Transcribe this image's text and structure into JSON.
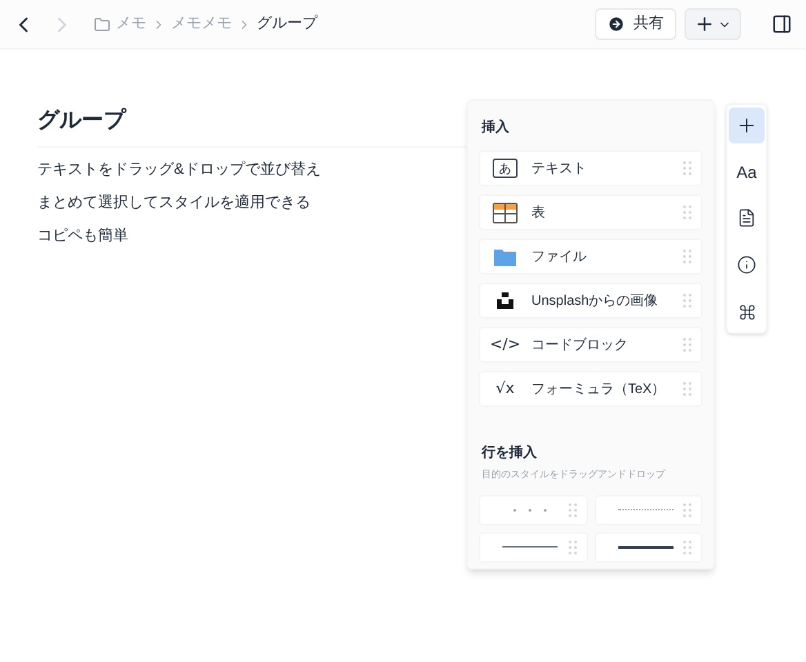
{
  "breadcrumb": [
    "メモ",
    "メモメモ",
    "グループ"
  ],
  "share_button": "共有",
  "document": {
    "title": "グループ",
    "lines": [
      "テキストをドラッグ&ドロップで並び替え",
      "まとめて選択してスタイルを適用できる",
      "コピペも簡単"
    ]
  },
  "insert_panel": {
    "title": "挿入",
    "items": [
      {
        "kind": "text",
        "label": "テキスト",
        "icon_text": "あ"
      },
      {
        "kind": "table",
        "label": "表"
      },
      {
        "kind": "file",
        "label": "ファイル"
      },
      {
        "kind": "image",
        "label": "Unsplashからの画像"
      },
      {
        "kind": "code",
        "label": "コードブロック",
        "icon_text": "</>"
      },
      {
        "kind": "formula",
        "label": "フォーミュラ（TeX）",
        "icon_text": "√x"
      }
    ],
    "divider_title": "行を挿入",
    "divider_hint": "目的のスタイルをドラッグアンドドロップ",
    "dividers": [
      {
        "kind": "dots"
      },
      {
        "kind": "dotted"
      },
      {
        "kind": "thin"
      },
      {
        "kind": "thick"
      }
    ]
  },
  "toolbar": [
    {
      "kind": "plus",
      "selected": true
    },
    {
      "kind": "text",
      "label": "Aa",
      "selected": false
    },
    {
      "kind": "page",
      "selected": false
    },
    {
      "kind": "info",
      "selected": false
    },
    {
      "kind": "command",
      "selected": false
    }
  ]
}
